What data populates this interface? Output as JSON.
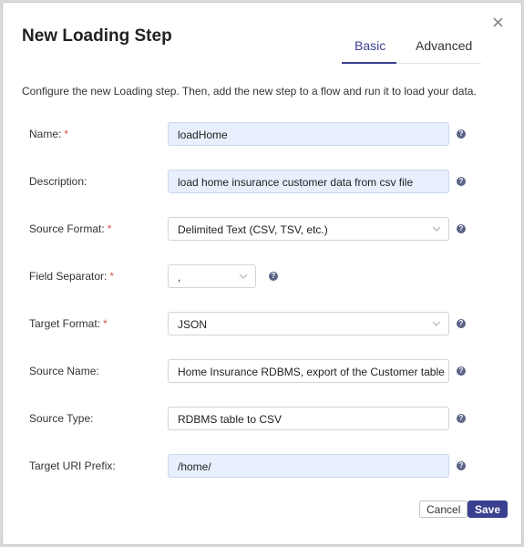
{
  "dialog": {
    "title": "New Loading Step",
    "close_icon": "close-icon",
    "description": "Configure the new Loading step. Then, add the new step to a flow and run it to load your data."
  },
  "tabs": [
    {
      "label": "Basic",
      "active": true
    },
    {
      "label": "Advanced",
      "active": false
    }
  ],
  "required_marker": "*",
  "help_glyph": "?",
  "form": {
    "name": {
      "label": "Name:",
      "required": true,
      "value": "loadHome"
    },
    "description": {
      "label": "Description:",
      "required": false,
      "value": "load home insurance customer data from csv file"
    },
    "source_format": {
      "label": "Source Format:",
      "required": true,
      "value": "Delimited Text (CSV, TSV, etc.)"
    },
    "field_separator": {
      "label": "Field Separator:",
      "required": true,
      "value": ","
    },
    "target_format": {
      "label": "Target Format:",
      "required": true,
      "value": "JSON"
    },
    "source_name": {
      "label": "Source Name:",
      "required": false,
      "value": "Home Insurance RDBMS, export of the Customer table"
    },
    "source_type": {
      "label": "Source Type:",
      "required": false,
      "value": "RDBMS table to CSV"
    },
    "target_uri_prefix": {
      "label": "Target URI Prefix:",
      "required": false,
      "value": "/home/"
    }
  },
  "buttons": {
    "cancel": "Cancel",
    "save": "Save"
  },
  "colors": {
    "accent": "#3b3f8f",
    "required": "#d9534f",
    "filled_input": "#e8f0fe",
    "help_icon": "#5a6486"
  }
}
